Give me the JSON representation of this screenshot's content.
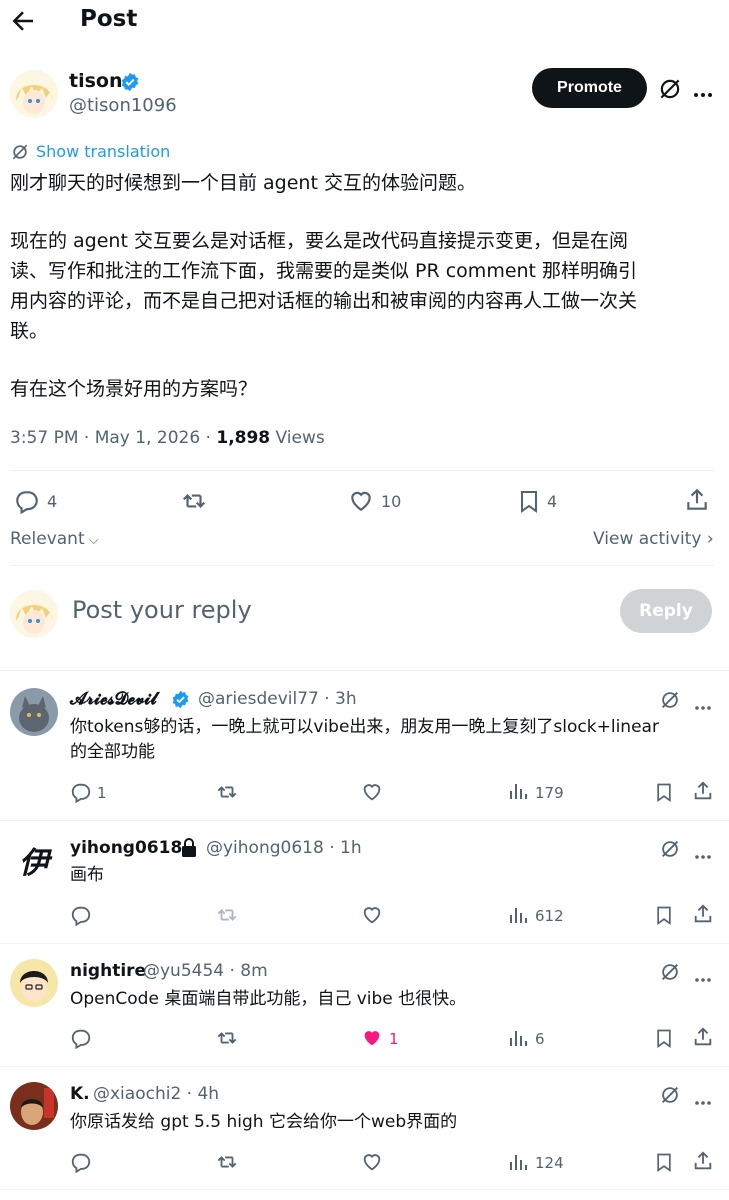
{
  "header": {
    "title": "Post"
  },
  "post": {
    "author_name": "tison",
    "author_handle": "@tison1096",
    "promote_label": "Promote",
    "show_translation": "Show translation",
    "text_line1": "刚才聊天的时候想到一个目前 agent 交互的体验问题。",
    "text_para2": "现在的 agent 交互要么是对话框，要么是改代码直接提示变更，但是在阅\n读、写作和批注的工作流下面，我需要的是类似 PR comment 那样明确引\n用内容的评论，而不是自己把对话框的输出和被审阅的内容再人工做一次关\n联。",
    "text_para3": "有在这个场景好用的方案吗？",
    "time": "3:57 PM · May 1, 2026 · ",
    "views_count": "1,898",
    "views_label": " Views",
    "replies": "4",
    "likes": "10",
    "bookmarks": "4",
    "sort_label": "Relevant",
    "view_activity": "View activity"
  },
  "composer": {
    "placeholder": "Post your reply",
    "reply_label": "Reply"
  },
  "replies": [
    {
      "name": "𝓐𝓻𝓲𝓮𝓼𝓓𝓮𝓿𝓲𝓵",
      "handle": "@ariesdevil77 · 3h",
      "text": "你tokens够的话，一晚上就可以vibe出来，朋友用一晚上复刻了slock+linear\n的全部功能",
      "reply_count": "1",
      "retweet_count": "",
      "like_count": "",
      "views": "179"
    },
    {
      "name": "yihong0618",
      "handle": "@yihong0618 · 1h",
      "text": "画布",
      "reply_count": "",
      "retweet_count": "",
      "like_count": "",
      "views": "612"
    },
    {
      "name": "nightire",
      "handle": "@yu5454 · 8m",
      "text": "OpenCode 桌面端自带此功能，自己 vibe 也很快。",
      "reply_count": "",
      "retweet_count": "",
      "like_count": "1",
      "views": "6"
    },
    {
      "name": "K.",
      "handle": "@xiaochi2 · 4h",
      "text": "你原话发给 gpt 5.5 high 它会给你一个web界面的",
      "reply_count": "",
      "retweet_count": "",
      "like_count": "",
      "views": "124"
    }
  ],
  "colors": {
    "accent": "#1d9bf0",
    "like_pink": "#f91880",
    "text": "#0f1419",
    "muted": "#536471"
  }
}
